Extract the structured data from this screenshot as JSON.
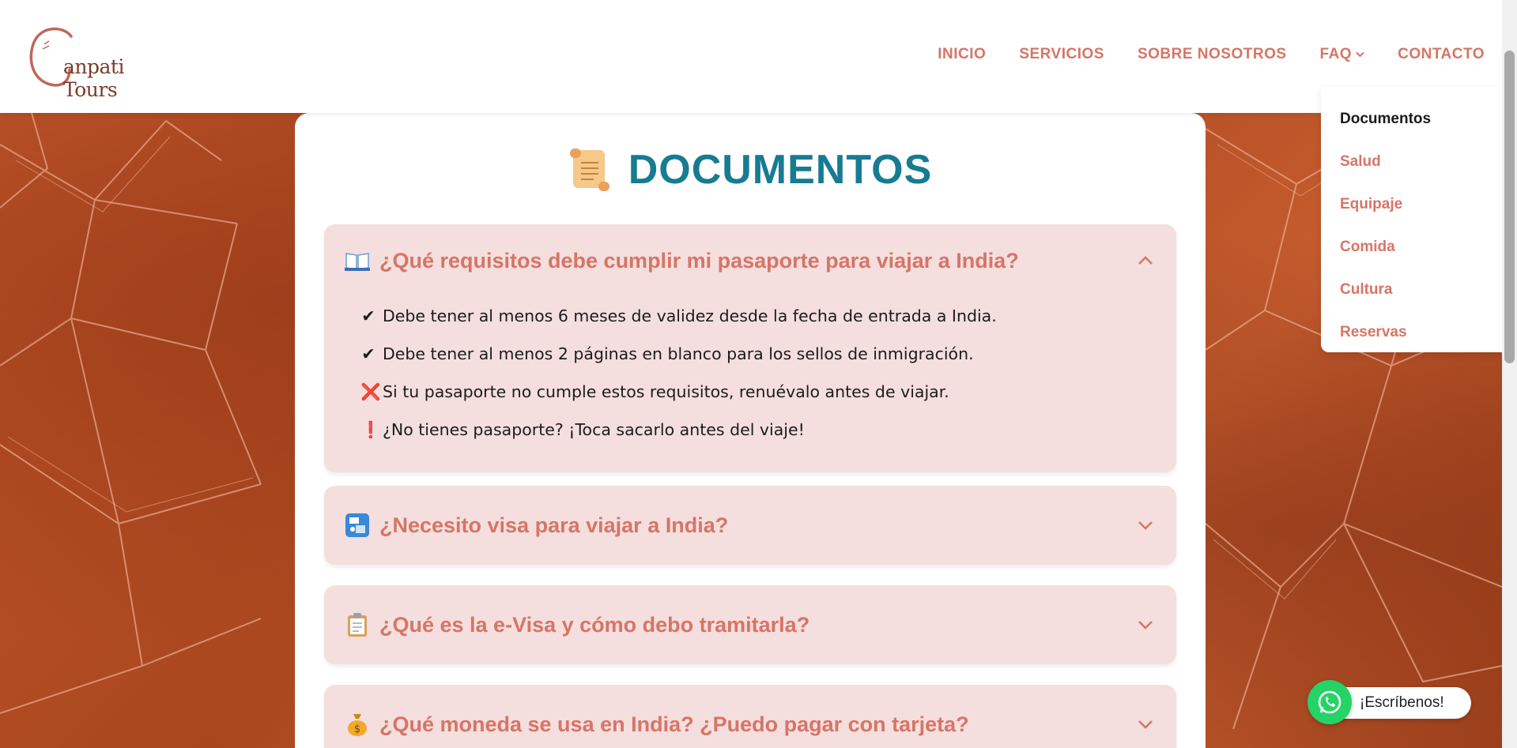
{
  "brand": {
    "logo_text": "anpati Tours"
  },
  "nav": {
    "items": [
      {
        "label": "INICIO"
      },
      {
        "label": "SERVICIOS"
      },
      {
        "label": "SOBRE NOSOTROS"
      },
      {
        "label": "FAQ"
      },
      {
        "label": "CONTACTO"
      }
    ]
  },
  "faq_menu": {
    "items": [
      {
        "label": "Documentos",
        "active": true
      },
      {
        "label": "Salud"
      },
      {
        "label": "Equipaje"
      },
      {
        "label": "Comida"
      },
      {
        "label": "Cultura"
      },
      {
        "label": "Reservas"
      }
    ]
  },
  "section": {
    "title": "DOCUMENTOS",
    "icon": "scroll-icon"
  },
  "faqs": [
    {
      "icon": "open-book-icon",
      "question": "¿Qué requisitos debe cumplir mi pasaporte para viajar a India?",
      "expanded": true,
      "answers": [
        {
          "mark": "✔",
          "text": "Debe tener al menos 6 meses de validez desde la fecha de entrada a India."
        },
        {
          "mark": "✔",
          "text": "Debe tener al menos 2 páginas en blanco para los sellos de inmigración."
        },
        {
          "mark": "❌",
          "text": "Si tu pasaporte no cumple estos requisitos, renuévalo antes de viajar."
        },
        {
          "mark": "❗",
          "text": "¿No tienes pasaporte? ¡Toca sacarlo antes del viaje!"
        }
      ]
    },
    {
      "icon": "passport-control-icon",
      "question": "¿Necesito visa para viajar a India?",
      "expanded": false
    },
    {
      "icon": "clipboard-icon",
      "question": "¿Qué es la e-Visa y cómo debo tramitarla?",
      "expanded": false
    },
    {
      "icon": "money-bag-icon",
      "question": "¿Qué moneda se usa en India? ¿Puedo pagar con tarjeta?",
      "expanded": false
    }
  ],
  "whatsapp": {
    "label": "¡Escríbenos!",
    "color": "#25d366"
  },
  "colors": {
    "accent": "#d67566",
    "title": "#177b92",
    "faq_bg": "#f5dede"
  }
}
